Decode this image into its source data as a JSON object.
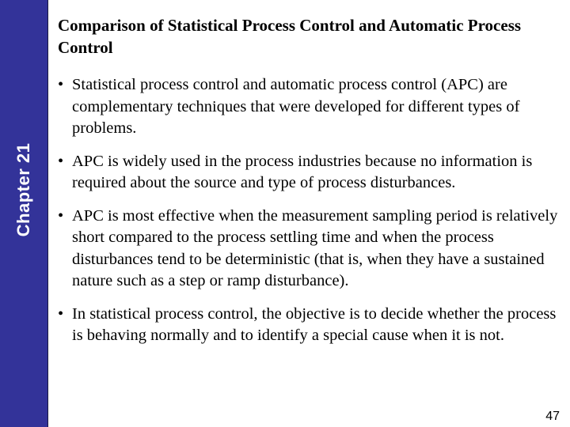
{
  "sidebar": {
    "chapter_label": "Chapter 21",
    "color": "#333399"
  },
  "title": "Comparison of Statistical Process Control and Automatic Process Control",
  "bullet_symbol": "•",
  "bullets": [
    "Statistical process control and automatic process control (APC) are complementary techniques that were developed for different types of problems.",
    "APC is widely used in the process industries because no information is required about the source and type of process disturbances.",
    "APC is most effective when the measurement sampling period is relatively short compared to the process settling time and when the process disturbances tend to be deterministic (that is, when they have a sustained nature such as a step or ramp disturbance).",
    "In statistical process control, the objective is to decide whether the process is behaving normally and to identify a special cause when it is not."
  ],
  "page_number": "47"
}
